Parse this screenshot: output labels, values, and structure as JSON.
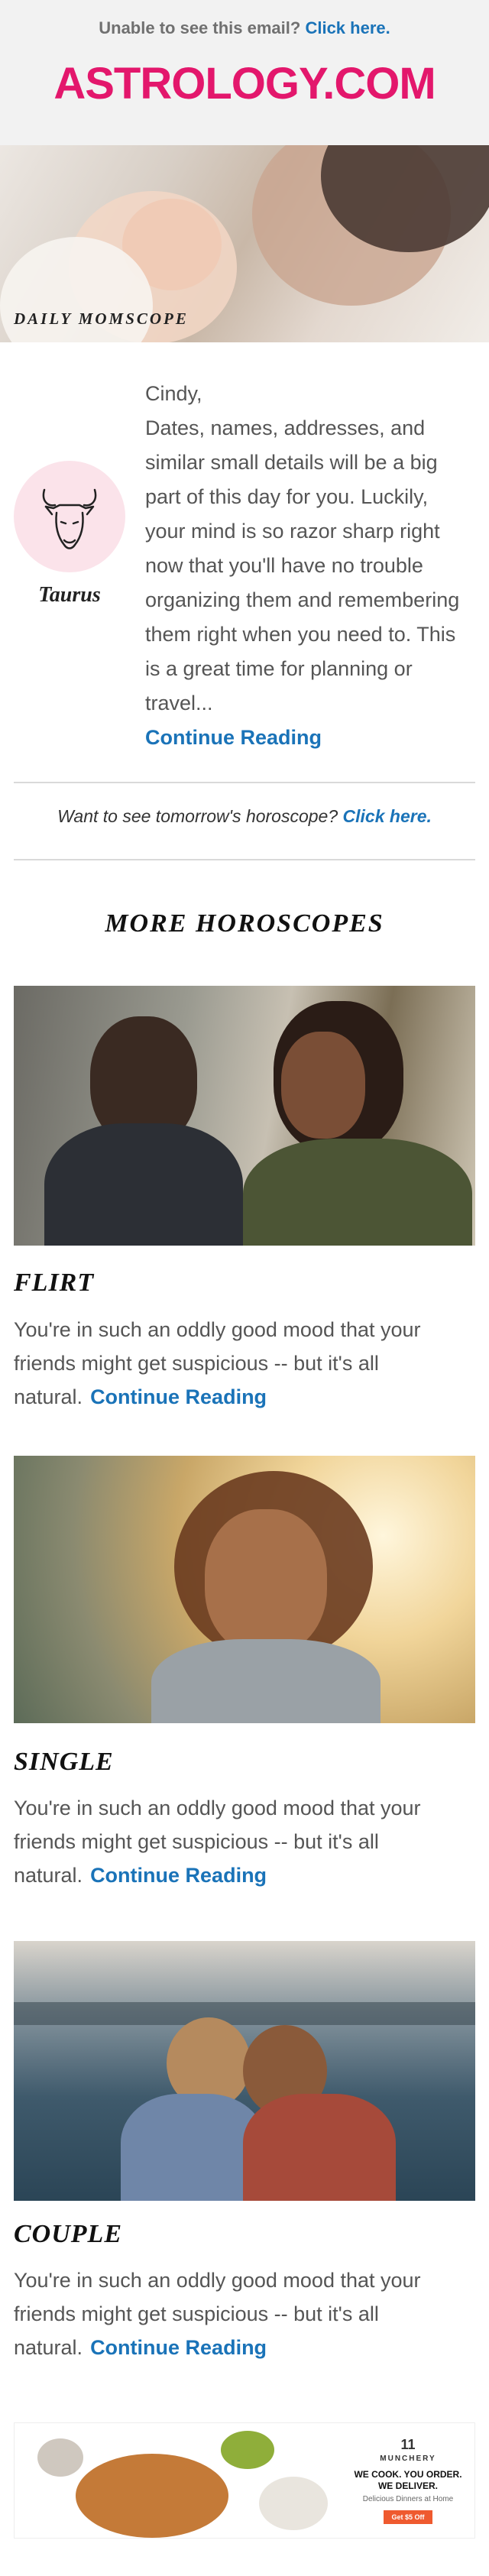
{
  "header": {
    "unable_text": "Unable to see this email?",
    "unable_link": "Click here.",
    "logo": "ASTROLOGY.COM"
  },
  "hero": {
    "label": "DAILY MOMSCOPE"
  },
  "daily": {
    "sign_icon": "taurus-bull-icon",
    "sign_name": "Taurus",
    "greeting": "Cindy,",
    "text": "Dates, names, addresses, and similar small details will be a big part of this day for you. Luckily, your mind is so razor sharp right now that you'll have no trouble organizing them and remembering them right when you need to. This is a great time for planning or travel...",
    "link": "Continue Reading"
  },
  "tomorrow": {
    "text": "Want to see tomorrow's horoscope?",
    "link": "Click here."
  },
  "more": {
    "title": "MORE HOROSCOPES",
    "sections": [
      {
        "title": "FLIRT",
        "text": "You're in such an oddly good mood that your friends might get suspicious -- but it's all natural.",
        "link": "Continue Reading"
      },
      {
        "title": "SINGLE",
        "text": "You're in such an oddly good mood that your friends might get suspicious -- but it's all natural.",
        "link": "Continue Reading"
      },
      {
        "title": "COUPLE",
        "text": "You're in such an oddly good mood that your friends might get suspicious -- but it's all natural.",
        "link": "Continue Reading"
      }
    ]
  },
  "ad": {
    "number": "11",
    "brand": "MUNCHERY",
    "tagline": "WE COOK. YOU ORDER. WE DELIVER.",
    "sub": "Delicious Dinners at Home",
    "button": "Get $5 Off"
  }
}
